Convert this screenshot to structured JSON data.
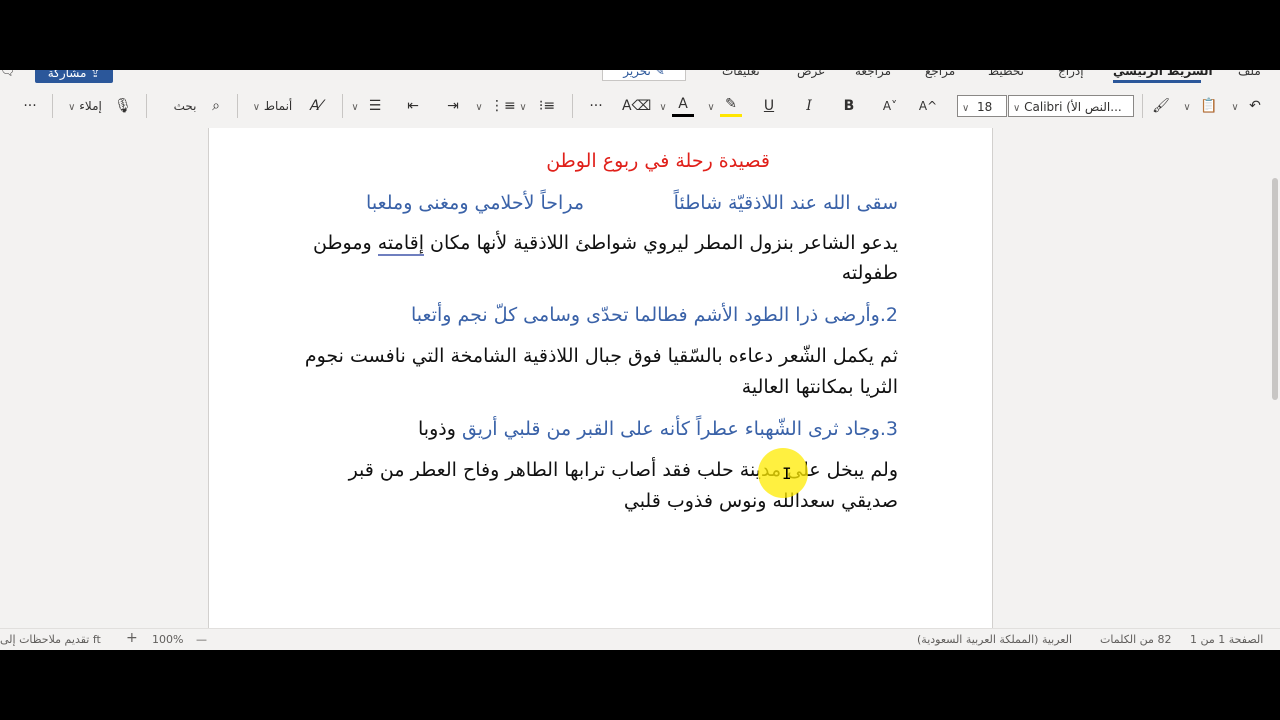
{
  "tabs": {
    "file": "ملف",
    "home": "الشريط الرئيسي",
    "insert": "إدراج",
    "layout": "تخطيط",
    "references": "مراجع",
    "review": "مراجعة",
    "view": "عرض",
    "comments": "تعليقات",
    "editing": "تحرير",
    "share": "مشاركة"
  },
  "toolbar": {
    "font_name": "Calibri (النص الأ...",
    "font_size": "18",
    "styles_label": "أنماط",
    "search_label": "بحث",
    "dictate_label": "إملاء",
    "bold": "B",
    "italic": "I",
    "underline": "U",
    "more": "···",
    "grow": "A^",
    "shrink": "A˅",
    "font_color": "A"
  },
  "document": {
    "title": "قصيدة رحلة في ربوع الوطن",
    "verse1_a": "سقى الله عند اللاذقيّة شاطئاً",
    "verse1_b": "مراحاً لأحلامي ومغنى وملعبا",
    "explain1_line1_pre": "يدعو الشاعر بنزول المطر ليروي شواطئ اللاذقية لأنها مكان",
    "explain1_line1_word": "إقامته",
    "explain1_line1_post": "وموطن",
    "explain1_line2": "طفولته",
    "verse2": "2.وأرضى ذرا الطود الأشم فطالما   تحدّى وسامى كلّ نجم وأتعبا",
    "explain2_line1": "ثم يكمل الشّعر دعاءه بالسّقيا فوق جبال اللاذقية الشامخة التي نافست نجوم",
    "explain2_line2": "الثريا بمكانتها العالية",
    "verse3_pre": "3.وجاد ثرى الشّهباء عطراً كأنه   على القبر من قلبي أريق",
    "verse3_post": "وذوبا",
    "explain3_line1": "ولم يبخل على مدينة حلب فقد أصاب ترابها الطاهر وفاح العطر من قبر",
    "explain3_line2": "صديقي سعدالله ونوس فذوب قلبي"
  },
  "status": {
    "page": "الصفحة 1 من 1",
    "words": "82 من الكلمات",
    "language": "العربية (المملكة العربية السعودية)",
    "feedback": "تقديم ملاحظات إلى ft",
    "zoom": "100%",
    "zoom_in": "+",
    "zoom_out": "—"
  },
  "colors": {
    "accent": "#2b579a",
    "title_red": "#e0201a",
    "verse_blue": "#3a62a8"
  }
}
